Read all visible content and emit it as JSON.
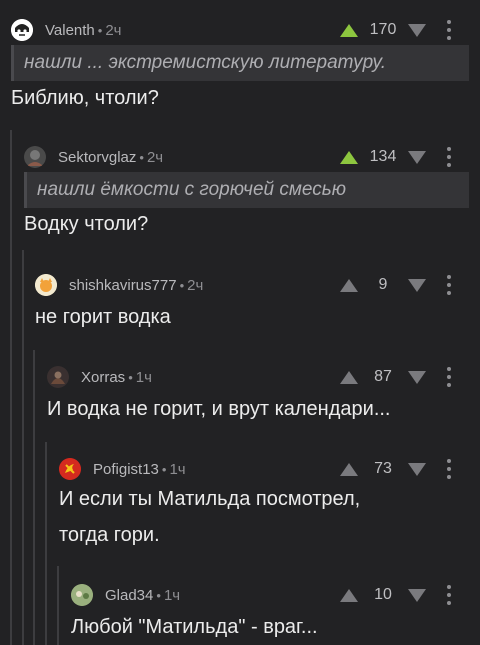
{
  "comments": [
    {
      "username": "Valenth",
      "time": "2ч",
      "score": "170",
      "voted_up": true,
      "quote": "нашли ... экстремистскую литературу.",
      "text_lines": [
        "Библию, чтоли?"
      ],
      "avatar_icon": "skull-girl-avatar"
    },
    {
      "username": "Sektorvglaz",
      "time": "2ч",
      "score": "134",
      "voted_up": true,
      "quote": "нашли ёмкости с горючей смесью",
      "text_lines": [
        "Водку чтоли?"
      ],
      "avatar_icon": "dark-avatar"
    },
    {
      "username": "shishkavirus777",
      "time": "2ч",
      "score": "9",
      "voted_up": false,
      "text_lines": [
        "не горит водка"
      ],
      "avatar_icon": "cat-avatar"
    },
    {
      "username": "Xorras",
      "time": "1ч",
      "score": "87",
      "voted_up": false,
      "text_lines": [
        "И водка не горит, и врут календари..."
      ],
      "avatar_icon": "dark-avatar"
    },
    {
      "username": "Pofigist13",
      "time": "1ч",
      "score": "73",
      "voted_up": false,
      "text_lines": [
        "И если ты Матильда посмотрел,",
        "тогда гори."
      ],
      "avatar_icon": "red-emblem-avatar"
    },
    {
      "username": "Glad34",
      "time": "1ч",
      "score": "10",
      "voted_up": false,
      "text_lines": [
        "Любой \"Матильда\" - враг..."
      ],
      "avatar_icon": "green-avatar"
    }
  ],
  "colors": {
    "background": "#222224",
    "upvote_active": "#8dc63f",
    "thread_line": "#3d3d40"
  }
}
